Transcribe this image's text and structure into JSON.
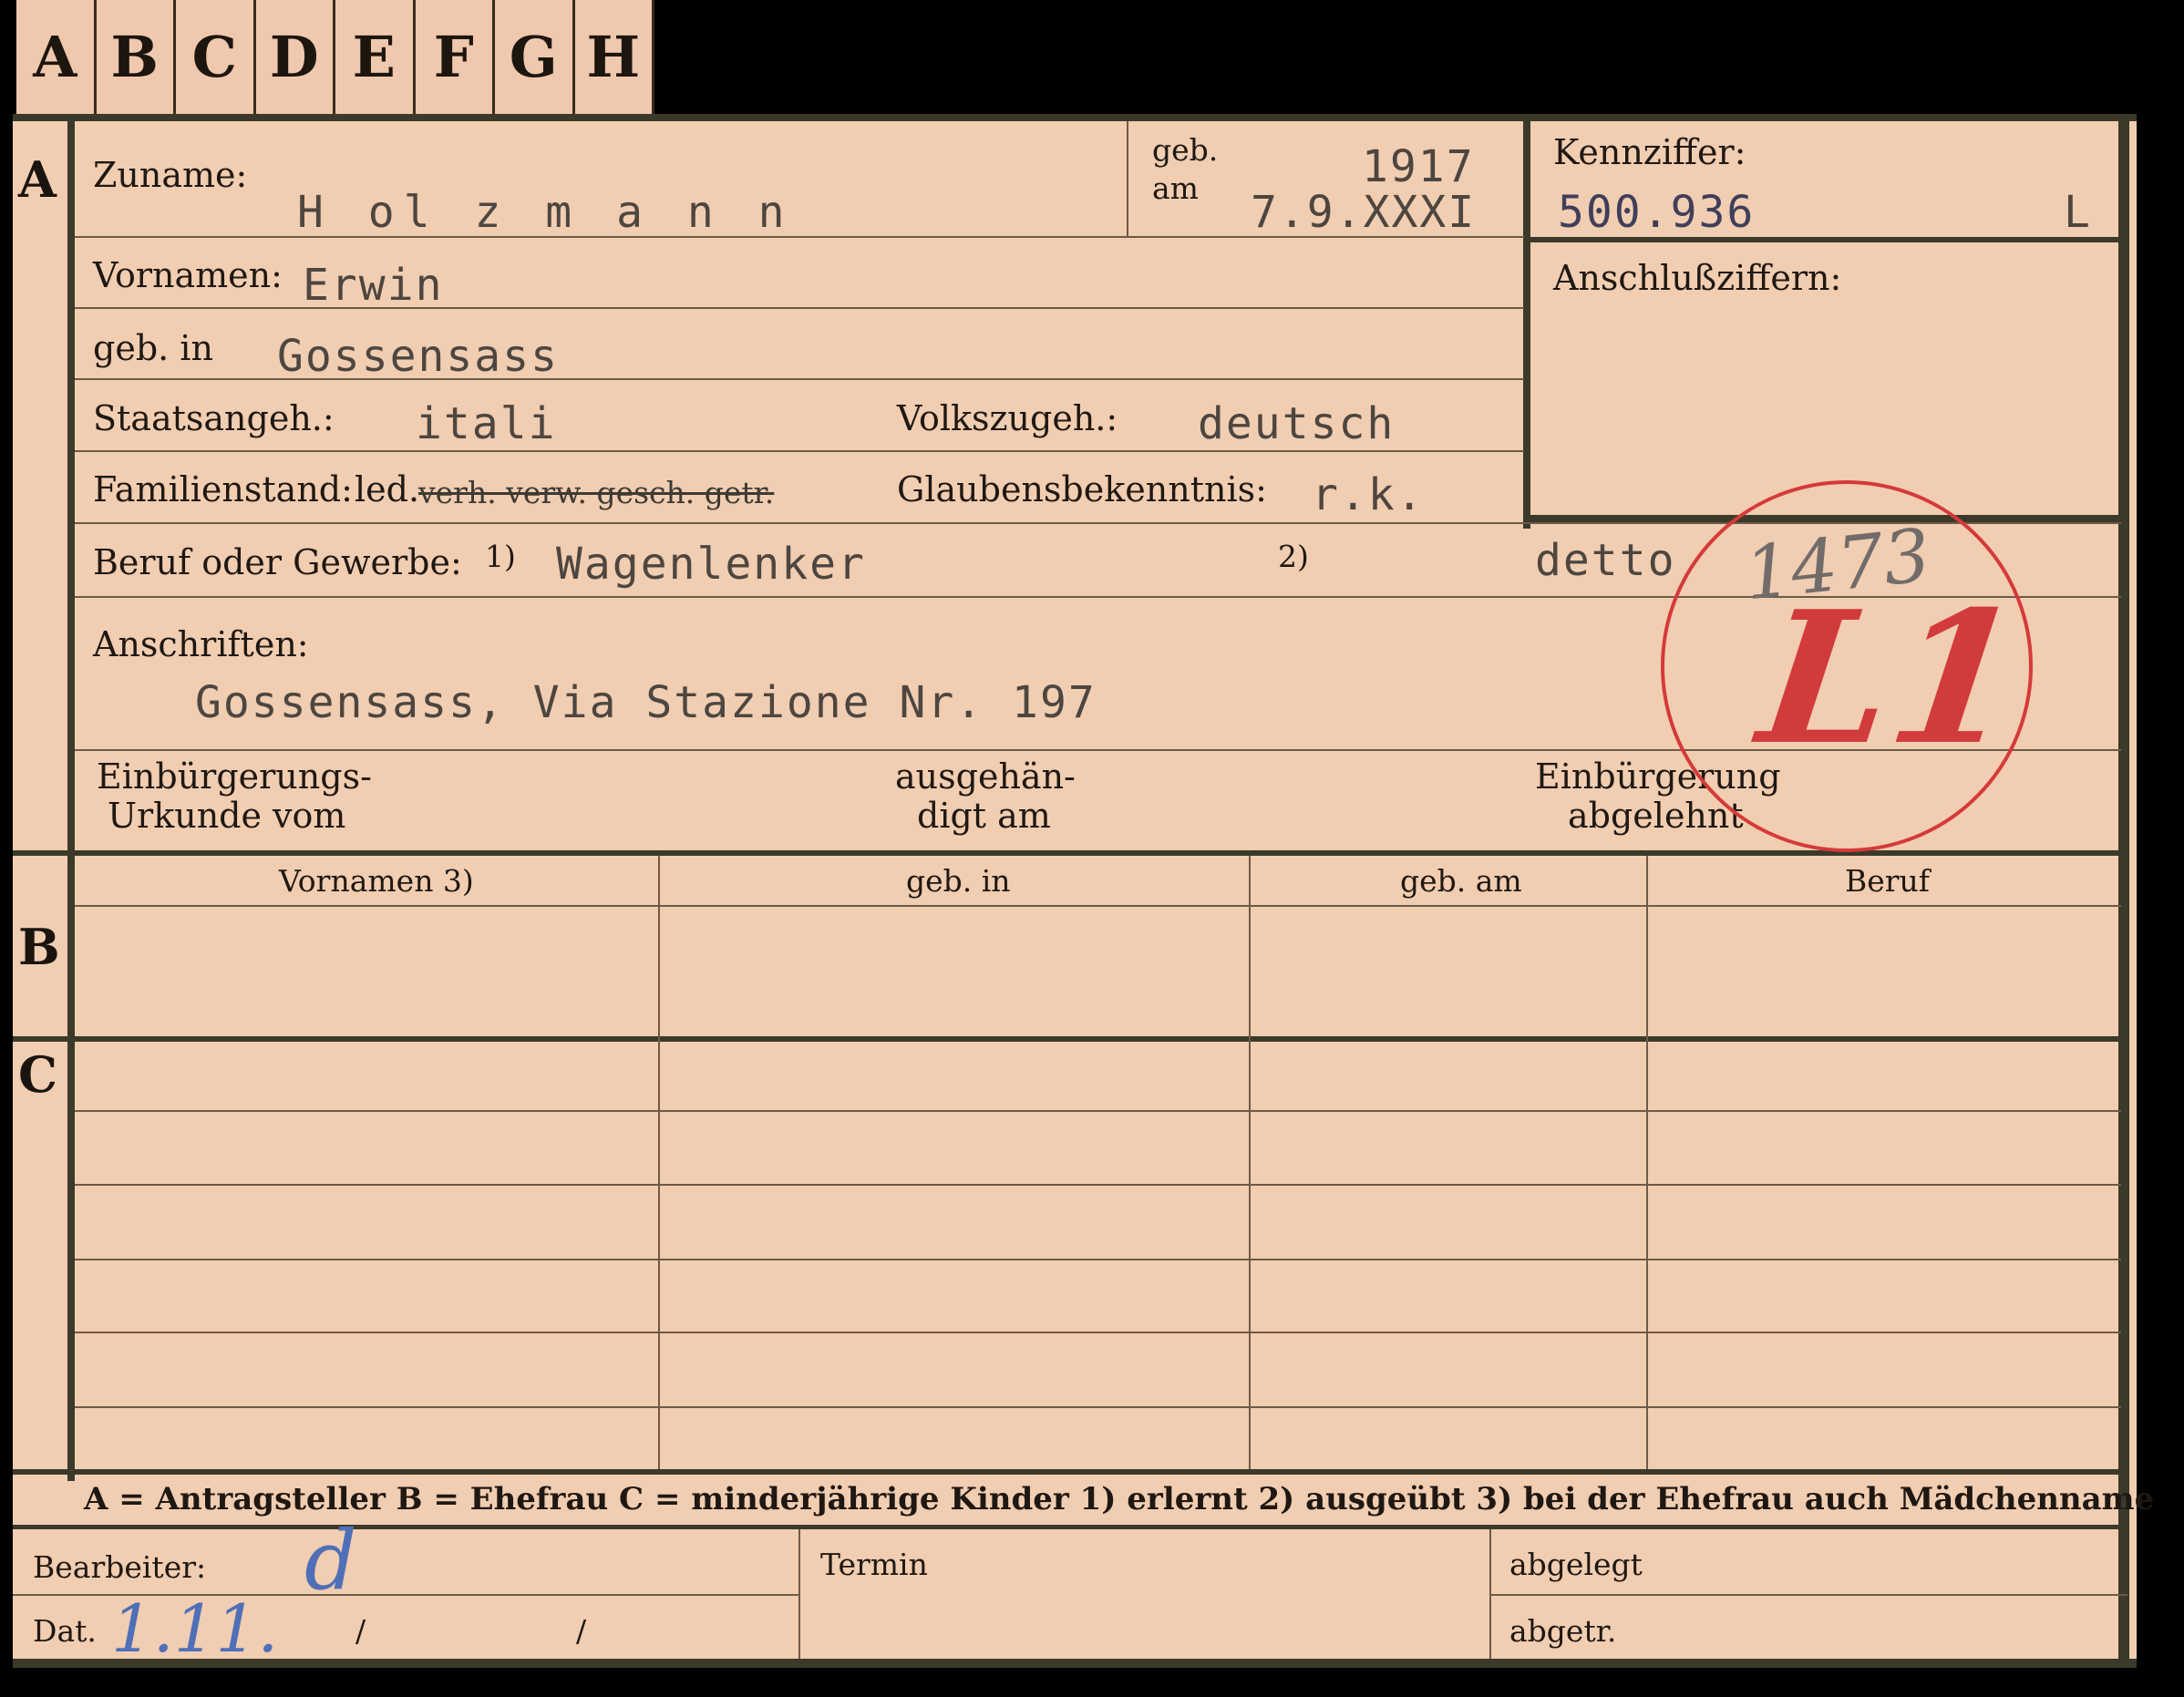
{
  "tabs": [
    "A",
    "B",
    "C",
    "D",
    "E",
    "F",
    "G",
    "H"
  ],
  "sections": {
    "a": "A",
    "b": "B",
    "c": "C"
  },
  "card": {
    "surname_label": "Zuname:",
    "surname_value": "H ol z m a n n",
    "birth_label_1": "geb.",
    "birth_label_2": "am",
    "birth_year": "1917",
    "birth_date": "7.9.XXXI",
    "id_label": "Kennziffer:",
    "id_value": "500.936",
    "id_suffix": "L",
    "connection_label": "Anschlußziffern:",
    "firstname_label": "Vornamen:",
    "firstname_value": "Erwin",
    "birthplace_label": "geb. in",
    "birthplace_value": "Gossensass",
    "citizenship_label": "Staatsangeh.:",
    "citizenship_value": "itali",
    "ethnicity_label": "Volkszugeh.:",
    "ethnicity_value": "deutsch",
    "marital_label": "Familienstand:",
    "marital_value": "led.",
    "marital_struck": "verh. verw. gesch. getr.",
    "religion_label": "Glaubensbekenntnis:",
    "religion_value": "r.k.",
    "occupation_label": "Beruf oder Gewerbe:",
    "occ_note1": "1)",
    "occupation_value": "Wagenlenker",
    "occ_note2": "2)",
    "occupation_value2": "detto",
    "address_label": "Anschriften:",
    "address_value": "Gossensass, Via Stazione Nr. 197",
    "naturalization_label_1": "Einbürgerungs-",
    "naturalization_label_2": "Urkunde vom",
    "handed_label_1": "ausgehän-",
    "handed_label_2": "digt am",
    "rejected_label_1": "Einbürgerung",
    "rejected_label_2": "abgelehnt",
    "stamp_number": "1473",
    "stamp_mark": "L1"
  },
  "table": {
    "headers": [
      "Vornamen 3)",
      "geb. in",
      "geb. am",
      "Beruf"
    ]
  },
  "legend": "A = Antragsteller   B = Ehefrau   C = minderjährige Kinder   1) erlernt   2) ausgeübt   3) bei der Ehefrau auch Mädchenname",
  "footer": {
    "clerk_label": "Bearbeiter:",
    "clerk_value": "d",
    "date_label": "Dat.",
    "date_value": "1.11.",
    "slash": "/",
    "deadline_label": "Termin",
    "filed_label": "abgelegt",
    "removed_label": "abgetr."
  },
  "colors": {
    "card": "#f1cdb1",
    "border": "#3b3a2a",
    "stamp": "#d53a3a",
    "ink": "#4f6fb8"
  }
}
